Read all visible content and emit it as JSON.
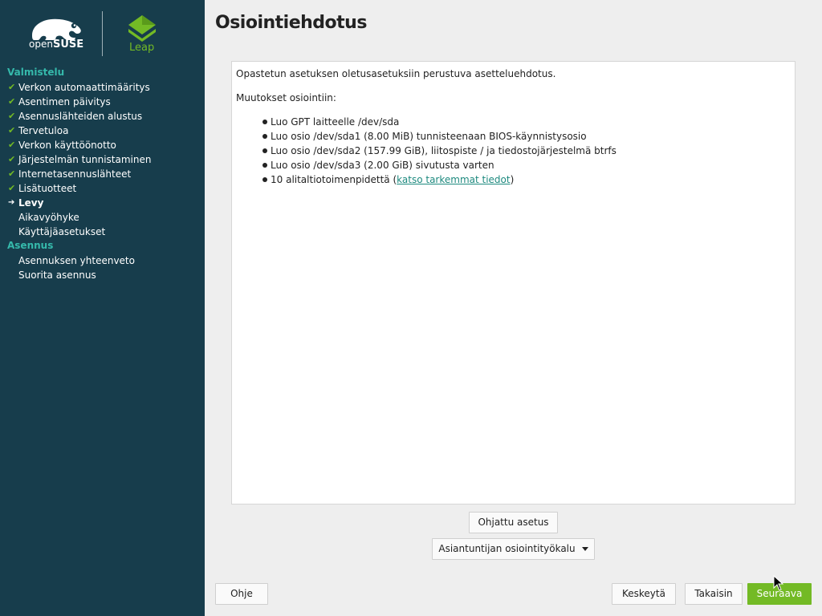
{
  "sidebar": {
    "brand": {
      "suse_prefix": "open",
      "suse_name": "SUSE",
      "product": "Leap"
    },
    "sections": [
      {
        "header": "Valmistelu",
        "items": [
          {
            "label": "Verkon automaattimääritys",
            "state": "done"
          },
          {
            "label": "Asentimen päivitys",
            "state": "done"
          },
          {
            "label": "Asennuslähteiden alustus",
            "state": "done"
          },
          {
            "label": "Tervetuloa",
            "state": "done"
          },
          {
            "label": "Verkon käyttöönotto",
            "state": "done"
          },
          {
            "label": "Järjestelmän tunnistaminen",
            "state": "done"
          },
          {
            "label": "Internetasennuslähteet",
            "state": "done"
          },
          {
            "label": "Lisätuotteet",
            "state": "done"
          },
          {
            "label": "Levy",
            "state": "current"
          },
          {
            "label": "Aikavyöhyke",
            "state": "pending"
          },
          {
            "label": "Käyttäjäasetukset",
            "state": "pending"
          }
        ]
      },
      {
        "header": "Asennus",
        "items": [
          {
            "label": "Asennuksen yhteenveto",
            "state": "pending"
          },
          {
            "label": "Suorita asennus",
            "state": "pending"
          }
        ]
      }
    ]
  },
  "main": {
    "title": "Osiointiehdotus",
    "intro": "Opastetun asetuksen oletusasetuksiin perustuva asetteluehdotus.",
    "changes_heading": "Muutokset osiointiin:",
    "changes": [
      "Luo GPT laitteelle /dev/sda",
      "Luo osio /dev/sda1 (8.00 MiB) tunnisteenaan BIOS-käynnistysosio",
      "Luo osio /dev/sda2 (157.99 GiB), liitospiste / ja tiedostojärjestelmä btrfs",
      "Luo osio /dev/sda3 (2.00 GiB) sivutusta varten"
    ],
    "subtasks_prefix": "10 alitaltiotoimenpidettä (",
    "subtasks_link": "katso tarkemmat tiedot",
    "subtasks_suffix": ")",
    "guided_setup": "Ohjattu asetus",
    "expert_partitioner": "Asiantuntijan osiointityökalu"
  },
  "footer": {
    "help": "Ohje",
    "abort": "Keskeytä",
    "back": "Takaisin",
    "next": "Seuraava"
  },
  "colors": {
    "sidebar_bg": "#173d4c",
    "accent_green": "#73ba25",
    "section_teal": "#35b9ab",
    "link": "#1e8a7f"
  }
}
